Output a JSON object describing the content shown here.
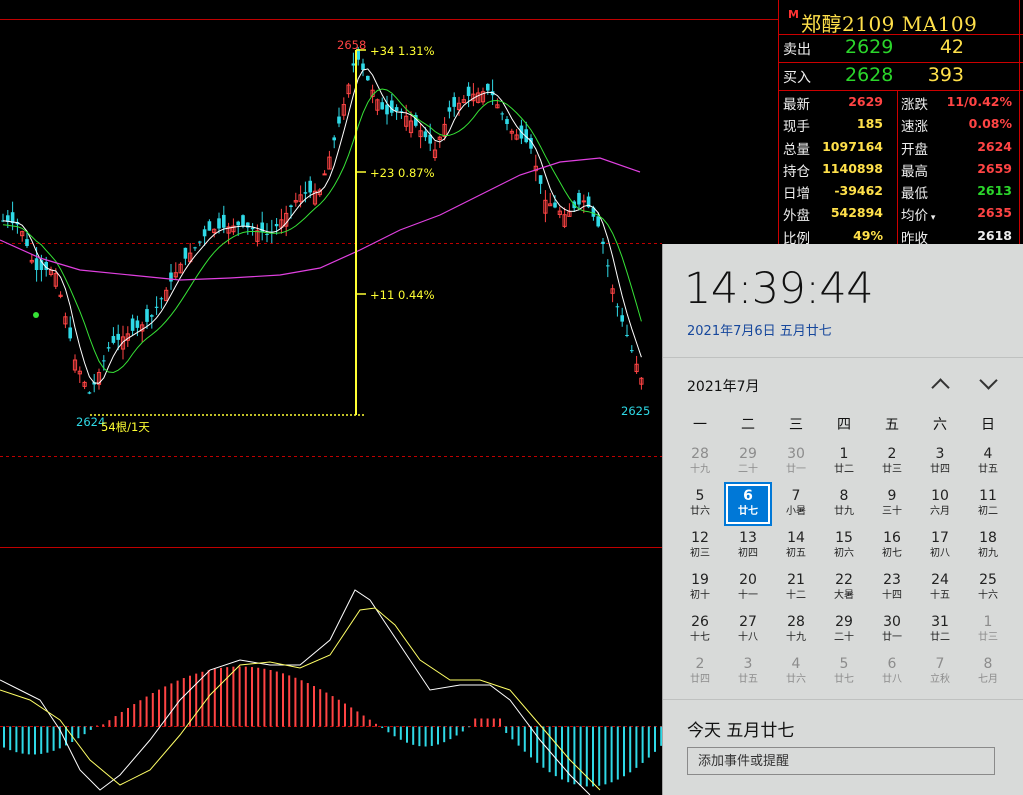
{
  "chart": {
    "high_label": "2658",
    "low_label": "2624",
    "last_label": "2625",
    "span_label": "54根/1天",
    "rulers": [
      {
        "delta": "+34",
        "pct": "1.31%"
      },
      {
        "delta": "+23",
        "pct": "0.87%"
      },
      {
        "delta": "+11",
        "pct": "0.44%"
      }
    ],
    "colors": {
      "up": "#ff4444",
      "down": "#2fd9e6",
      "ma_fast": "#ffffff",
      "ma_mid": "#36e236",
      "ma_slow": "#e040e0",
      "ruler": "#ffff33",
      "grid": "#c00000"
    }
  },
  "quote": {
    "badge": "M",
    "title": "郑醇2109  MA109",
    "ask_label": "卖出",
    "ask_price": "2629",
    "ask_vol": "42",
    "bid_label": "买入",
    "bid_price": "2628",
    "bid_vol": "393",
    "rows": [
      {
        "l1": "最新",
        "v1": "2629",
        "c1": "#ff4444",
        "l2": "涨跌",
        "v2": "11/0.42%",
        "c2": "#ff4444"
      },
      {
        "l1": "现手",
        "v1": "185",
        "c1": "#ffe04a",
        "l2": "速涨",
        "v2": "0.08%",
        "c2": "#ff4444"
      },
      {
        "l1": "总量",
        "v1": "1097164",
        "c1": "#ffe04a",
        "l2": "开盘",
        "v2": "2624",
        "c2": "#ff4444"
      },
      {
        "l1": "持仓",
        "v1": "1140898",
        "c1": "#ffe04a",
        "l2": "最高",
        "v2": "2659",
        "c2": "#ff4444"
      },
      {
        "l1": "日增",
        "v1": "-39462",
        "c1": "#ffe04a",
        "l2": "最低",
        "v2": "2613",
        "c2": "#2bd62b"
      },
      {
        "l1": "外盘",
        "v1": "542894",
        "c1": "#ffe04a",
        "l2": "均价",
        "v2": "2635",
        "c2": "#ff4444"
      },
      {
        "l1": "比例",
        "v1": "49%",
        "c1": "#ffe04a",
        "l2": "昨收",
        "v2": "2618",
        "c2": "#eeeeee"
      }
    ]
  },
  "calendar": {
    "time": "14:39:44",
    "date": "2021年7月6日  五月廿七",
    "month": "2021年7月",
    "weekdays": [
      "一",
      "二",
      "三",
      "四",
      "五",
      "六",
      "日"
    ],
    "days": [
      {
        "n": "28",
        "lu": "十九",
        "other": true
      },
      {
        "n": "29",
        "lu": "二十",
        "other": true
      },
      {
        "n": "30",
        "lu": "廿一",
        "other": true
      },
      {
        "n": "1",
        "lu": "廿二"
      },
      {
        "n": "2",
        "lu": "廿三"
      },
      {
        "n": "3",
        "lu": "廿四"
      },
      {
        "n": "4",
        "lu": "廿五"
      },
      {
        "n": "5",
        "lu": "廿六"
      },
      {
        "n": "6",
        "lu": "廿七",
        "today": true
      },
      {
        "n": "7",
        "lu": "小暑"
      },
      {
        "n": "8",
        "lu": "廿九"
      },
      {
        "n": "9",
        "lu": "三十"
      },
      {
        "n": "10",
        "lu": "六月"
      },
      {
        "n": "11",
        "lu": "初二"
      },
      {
        "n": "12",
        "lu": "初三"
      },
      {
        "n": "13",
        "lu": "初四"
      },
      {
        "n": "14",
        "lu": "初五"
      },
      {
        "n": "15",
        "lu": "初六"
      },
      {
        "n": "16",
        "lu": "初七"
      },
      {
        "n": "17",
        "lu": "初八"
      },
      {
        "n": "18",
        "lu": "初九"
      },
      {
        "n": "19",
        "lu": "初十"
      },
      {
        "n": "20",
        "lu": "十一"
      },
      {
        "n": "21",
        "lu": "十二"
      },
      {
        "n": "22",
        "lu": "大暑"
      },
      {
        "n": "23",
        "lu": "十四"
      },
      {
        "n": "24",
        "lu": "十五"
      },
      {
        "n": "25",
        "lu": "十六"
      },
      {
        "n": "26",
        "lu": "十七"
      },
      {
        "n": "27",
        "lu": "十八"
      },
      {
        "n": "28",
        "lu": "十九"
      },
      {
        "n": "29",
        "lu": "二十"
      },
      {
        "n": "30",
        "lu": "廿一"
      },
      {
        "n": "31",
        "lu": "廿二"
      },
      {
        "n": "1",
        "lu": "廿三",
        "other": true
      },
      {
        "n": "2",
        "lu": "廿四",
        "other": true
      },
      {
        "n": "3",
        "lu": "廿五",
        "other": true
      },
      {
        "n": "4",
        "lu": "廿六",
        "other": true
      },
      {
        "n": "5",
        "lu": "廿七",
        "other": true
      },
      {
        "n": "6",
        "lu": "廿八",
        "other": true
      },
      {
        "n": "7",
        "lu": "立秋",
        "other": true
      },
      {
        "n": "8",
        "lu": "七月",
        "other": true
      }
    ],
    "today_title": "今天 五月廿七",
    "event_placeholder": "添加事件或提醒"
  }
}
